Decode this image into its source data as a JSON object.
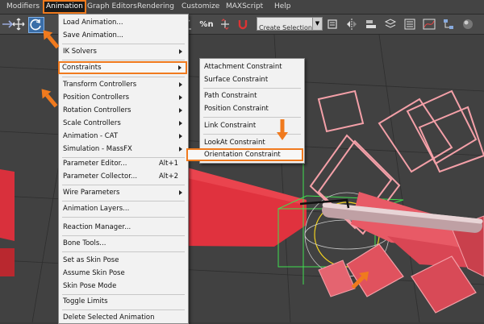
{
  "menubar": {
    "items": [
      {
        "label": "Modifiers"
      },
      {
        "label": "Animation"
      },
      {
        "label": "Graph Editors"
      },
      {
        "label": "Rendering"
      },
      {
        "label": "Customize"
      },
      {
        "label": "MAXScript"
      },
      {
        "label": "Help"
      }
    ]
  },
  "toolbar": {
    "selection_set_value": "Create Selection Se",
    "percent_snap_label": "%n"
  },
  "animation_menu": {
    "items": [
      {
        "label": "Load Animation..."
      },
      {
        "label": "Save Animation..."
      },
      {
        "label": "IK Solvers"
      },
      {
        "label": "Constraints"
      },
      {
        "label": "Transform Controllers"
      },
      {
        "label": "Position Controllers"
      },
      {
        "label": "Rotation Controllers"
      },
      {
        "label": "Scale Controllers"
      },
      {
        "label": "Animation - CAT"
      },
      {
        "label": "Simulation - MassFX"
      },
      {
        "label": "Parameter Editor...",
        "shortcut": "Alt+1"
      },
      {
        "label": "Parameter Collector...",
        "shortcut": "Alt+2"
      },
      {
        "label": "Wire Parameters"
      },
      {
        "label": "Animation Layers..."
      },
      {
        "label": "Reaction Manager..."
      },
      {
        "label": "Bone Tools..."
      },
      {
        "label": "Set as Skin Pose"
      },
      {
        "label": "Assume Skin Pose"
      },
      {
        "label": "Skin Pose Mode"
      },
      {
        "label": "Toggle Limits"
      },
      {
        "label": "Delete Selected Animation"
      }
    ]
  },
  "constraints_submenu": {
    "items": [
      {
        "label": "Attachment Constraint"
      },
      {
        "label": "Surface Constraint"
      },
      {
        "label": "Path Constraint"
      },
      {
        "label": "Position Constraint"
      },
      {
        "label": "Link Constraint"
      },
      {
        "label": "LookAt Constraint"
      },
      {
        "label": "Orientation Constraint"
      }
    ]
  },
  "colors": {
    "highlight_outline": "#f07a1e",
    "menu_background": "#f2f2f2",
    "viewport_background": "#414141",
    "object_red": "#e0323e",
    "object_pink_wire": "#f4a0a8"
  }
}
